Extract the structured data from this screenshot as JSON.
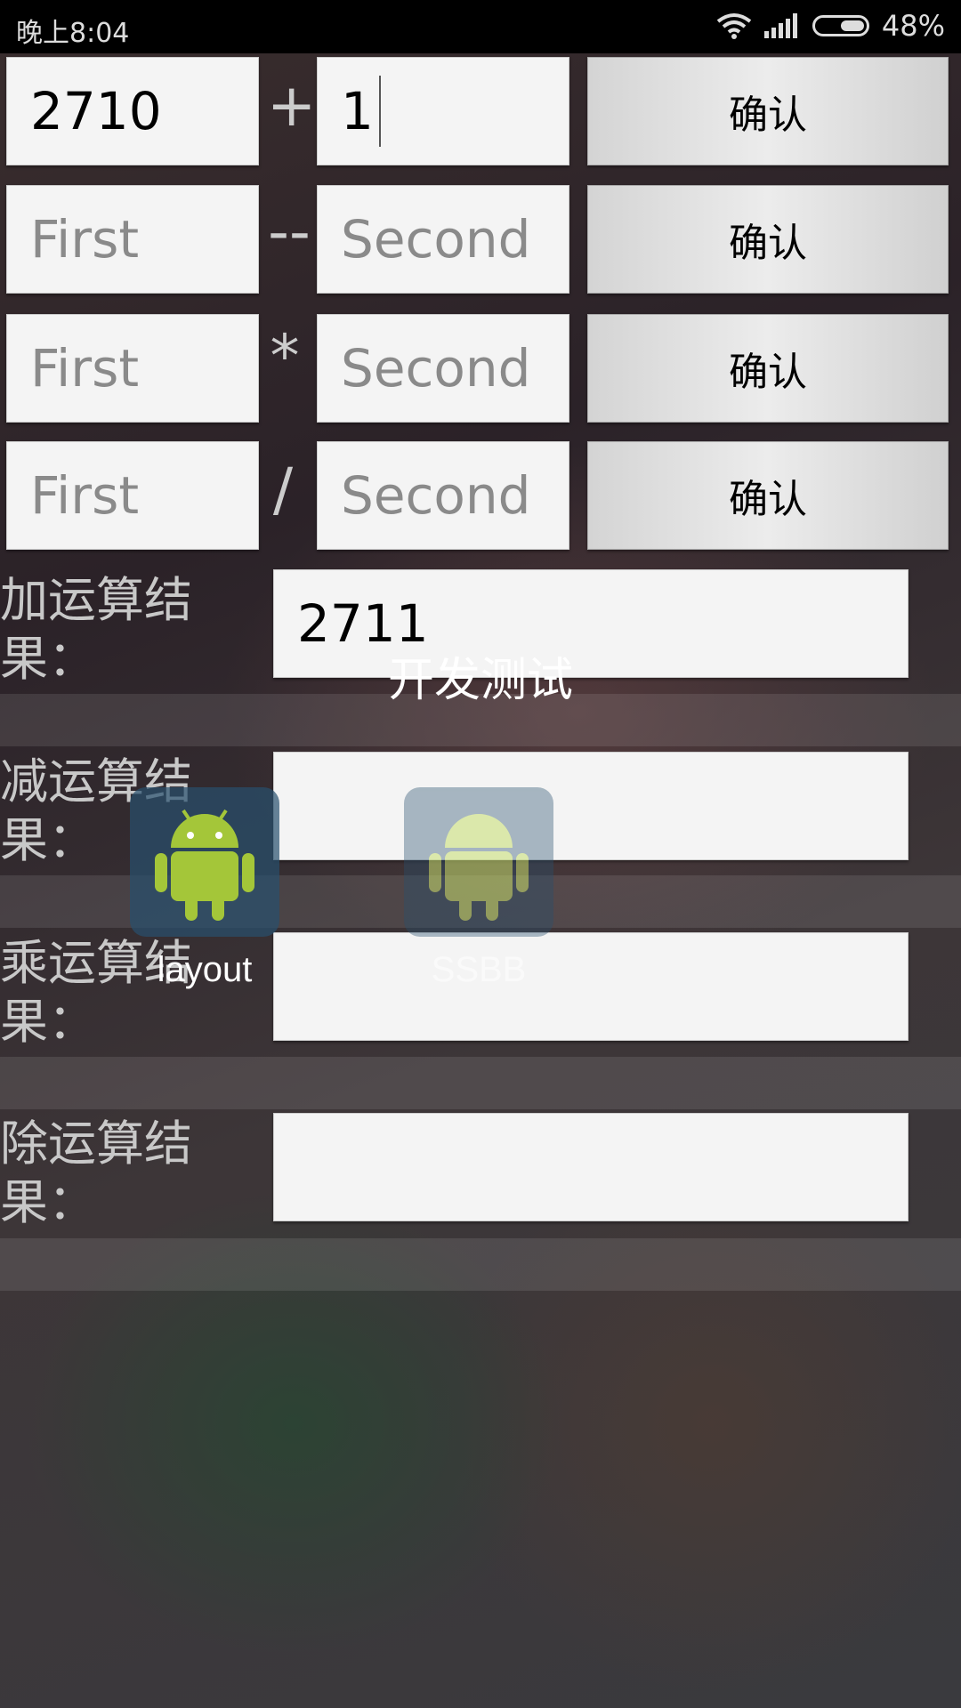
{
  "status_bar": {
    "time": "晚上8:04",
    "battery": "48%",
    "icons": [
      "wifi-icon",
      "signal-icon",
      "battery-icon"
    ]
  },
  "calc_rows": [
    {
      "first": "2710",
      "first_placeholder": "First",
      "operator": "+",
      "second": "1",
      "second_placeholder": "Second",
      "button": "确认"
    },
    {
      "first": "",
      "first_placeholder": "First",
      "operator": "--",
      "second": "",
      "second_placeholder": "Second",
      "button": "确认"
    },
    {
      "first": "",
      "first_placeholder": "First",
      "operator": "*",
      "second": "",
      "second_placeholder": "Second",
      "button": "确认"
    },
    {
      "first": "",
      "first_placeholder": "First",
      "operator": "/",
      "second": "",
      "second_placeholder": "Second",
      "button": "确认"
    }
  ],
  "results": [
    {
      "label": "加运算结果：",
      "value": "2711"
    },
    {
      "label": "减运算结果：",
      "value": ""
    },
    {
      "label": "乘运算结果：",
      "value": ""
    },
    {
      "label": "除运算结果：",
      "value": ""
    }
  ],
  "overlay": {
    "folder_title": "开发测试",
    "apps": [
      {
        "label": "layout"
      },
      {
        "label": "SSBB"
      }
    ]
  }
}
